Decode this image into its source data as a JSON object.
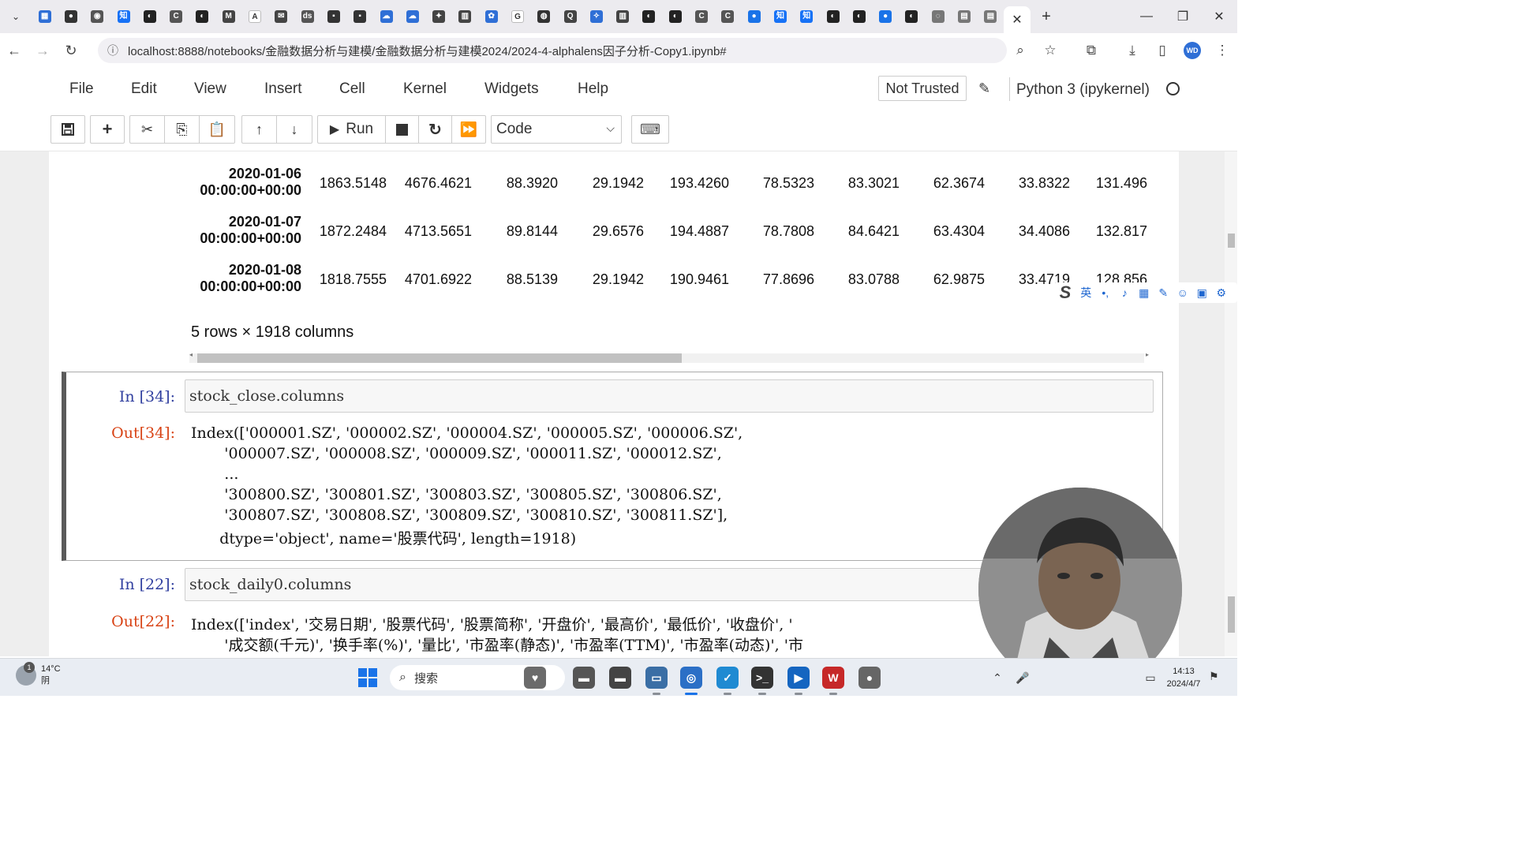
{
  "browser": {
    "tab_menu_glyph": "⌄",
    "tab_favicons": [
      {
        "name": "calendar",
        "color": "#2f6fd6",
        "glyph": "▦"
      },
      {
        "name": "chat",
        "color": "#333333",
        "glyph": "●"
      },
      {
        "name": "circle-app",
        "color": "#555555",
        "glyph": "◉"
      },
      {
        "name": "zhihu",
        "color": "#1772f6",
        "glyph": "知"
      },
      {
        "name": "github",
        "color": "#222222",
        "glyph": "◐"
      },
      {
        "name": "c-app",
        "color": "#555555",
        "glyph": "C"
      },
      {
        "name": "github",
        "color": "#222222",
        "glyph": "◐"
      },
      {
        "name": "m-app",
        "color": "#444444",
        "glyph": "M"
      },
      {
        "name": "a-app",
        "color": "#ffffff",
        "glyph": "A"
      },
      {
        "name": "mail",
        "color": "#444444",
        "glyph": "✉"
      },
      {
        "name": "ds-app",
        "color": "#555555",
        "glyph": "ds"
      },
      {
        "name": "square-app",
        "color": "#333333",
        "glyph": "▪"
      },
      {
        "name": "square-app",
        "color": "#333333",
        "glyph": "▪"
      },
      {
        "name": "cloud",
        "color": "#2f6fd6",
        "glyph": "☁"
      },
      {
        "name": "cloud",
        "color": "#2f6fd6",
        "glyph": "☁"
      },
      {
        "name": "run-app",
        "color": "#444444",
        "glyph": "✦"
      },
      {
        "name": "book-app",
        "color": "#444444",
        "glyph": "▥"
      },
      {
        "name": "paw-app",
        "color": "#2f6fd6",
        "glyph": "✿"
      },
      {
        "name": "google",
        "color": "#ffffff",
        "glyph": "G"
      },
      {
        "name": "globe",
        "color": "#333333",
        "glyph": "◍"
      },
      {
        "name": "q-app",
        "color": "#444444",
        "glyph": "Q"
      },
      {
        "name": "star-app",
        "color": "#2f6fd6",
        "glyph": "✧"
      },
      {
        "name": "book-app",
        "color": "#444444",
        "glyph": "▥"
      },
      {
        "name": "github",
        "color": "#222222",
        "glyph": "◐"
      },
      {
        "name": "github",
        "color": "#222222",
        "glyph": "◐"
      },
      {
        "name": "c-app",
        "color": "#555555",
        "glyph": "C"
      },
      {
        "name": "c-app",
        "color": "#555555",
        "glyph": "C"
      },
      {
        "name": "blue-app",
        "color": "#1a73e8",
        "glyph": "●"
      },
      {
        "name": "zhihu",
        "color": "#1772f6",
        "glyph": "知"
      },
      {
        "name": "zhihu",
        "color": "#1772f6",
        "glyph": "知"
      },
      {
        "name": "github",
        "color": "#222222",
        "glyph": "◐"
      },
      {
        "name": "github",
        "color": "#222222",
        "glyph": "◐"
      },
      {
        "name": "blue-app",
        "color": "#1a73e8",
        "glyph": "●"
      },
      {
        "name": "github",
        "color": "#222222",
        "glyph": "◐"
      },
      {
        "name": "loading",
        "color": "#777777",
        "glyph": "◌"
      },
      {
        "name": "doc-app",
        "color": "#777777",
        "glyph": "▤"
      },
      {
        "name": "doc-app",
        "color": "#777777",
        "glyph": "▤"
      }
    ],
    "active_tab_close": "✕",
    "new_tab": "+",
    "window_controls": {
      "minimize": "—",
      "restore": "❐",
      "close": "✕"
    },
    "nav": {
      "back": "←",
      "forward": "→",
      "reload": "↻"
    },
    "url_icon": "ⓘ",
    "url": "localhost:8888/notebooks/金融数据分析与建模/金融数据分析与建模2024/2024-4-alphalens因子分析-Copy1.ipynb#",
    "addr_icons": {
      "zoom": "⌕",
      "bookmark": "☆",
      "extensions": "⧉",
      "download": "⤓",
      "sidebar": "▯",
      "profile": "WD",
      "more": "⋮"
    }
  },
  "jupyter": {
    "menu": [
      "File",
      "Edit",
      "View",
      "Insert",
      "Cell",
      "Kernel",
      "Widgets",
      "Help"
    ],
    "trust": "Not Trusted",
    "kernel": "Python 3 (ipykernel)",
    "toolbar": {
      "run_label": "Run",
      "cell_type": "Code"
    }
  },
  "dataframe": {
    "rows": [
      {
        "date": "2020-01-06",
        "time": "00:00:00+00:00",
        "values": [
          "1863.5148",
          "4676.4621",
          "88.3920",
          "29.1942",
          "193.4260",
          "78.5323",
          "83.3021",
          "62.3674",
          "33.8322",
          "131.496"
        ]
      },
      {
        "date": "2020-01-07",
        "time": "00:00:00+00:00",
        "values": [
          "1872.2484",
          "4713.5651",
          "89.8144",
          "29.6576",
          "194.4887",
          "78.7808",
          "84.6421",
          "63.4304",
          "34.4086",
          "132.817"
        ]
      },
      {
        "date": "2020-01-08",
        "time": "00:00:00+00:00",
        "values": [
          "1818.7555",
          "4701.6922",
          "88.5139",
          "29.1942",
          "190.9461",
          "77.8696",
          "83.0788",
          "62.9875",
          "33.4719",
          "128.856"
        ]
      }
    ],
    "summary": "5 rows × 1918 columns"
  },
  "cells": [
    {
      "in_prompt": "In  [34]:",
      "code": "stock_close.columns",
      "out_prompt": "Out[34]:",
      "output": [
        "Index(['000001.SZ', '000002.SZ', '000004.SZ', '000005.SZ', '000006.SZ',",
        "       '000007.SZ', '000008.SZ', '000009.SZ', '000011.SZ', '000012.SZ',",
        "       ...",
        "       '300800.SZ', '300801.SZ', '300803.SZ', '300805.SZ', '300806.SZ',",
        "       '300807.SZ', '300808.SZ', '300809.SZ', '300810.SZ', '300811.SZ'],",
        "      dtype='object', name='股票代码', length=1918)"
      ]
    },
    {
      "in_prompt": "In  [22]:",
      "code": "stock_daily0.columns",
      "out_prompt": "Out[22]:",
      "output": [
        "Index(['index', '交易日期', '股票代码', '股票简称', '开盘价', '最高价', '最低价', '收盘价', '",
        "       '成交额(千元)', '换手率(%)', '量比', '市盈率(静态)', '市盈率(TTM)', '市盈率(动态)', '市"
      ]
    }
  ],
  "ime": {
    "logo": "S",
    "items": [
      "英",
      "•,",
      "♪",
      "▦",
      "✎",
      "☺",
      "▣",
      "⚙"
    ]
  },
  "taskbar": {
    "weather_badge": "1",
    "temperature": "14°C",
    "condition": "阴",
    "search_placeholder": "搜索",
    "apps": [
      {
        "name": "widgets",
        "color": "#6b6b6b",
        "glyph": "♥"
      },
      {
        "name": "file-manager",
        "color": "#555555",
        "glyph": "▬"
      },
      {
        "name": "terminal-dark",
        "color": "#444444",
        "glyph": "▬"
      },
      {
        "name": "folder",
        "color": "#3a6ea5",
        "glyph": "▭"
      },
      {
        "name": "chrome",
        "color": "#2b6fc6",
        "glyph": "◎"
      },
      {
        "name": "vscode-blue",
        "color": "#1f8ad2",
        "glyph": "✓"
      },
      {
        "name": "terminal",
        "color": "#333333",
        "glyph": ">_"
      },
      {
        "name": "recorder",
        "color": "#1565c0",
        "glyph": "▶"
      },
      {
        "name": "wps",
        "color": "#c62828",
        "glyph": "W"
      },
      {
        "name": "obs",
        "color": "#666666",
        "glyph": "●"
      }
    ],
    "tray": [
      "⌃",
      "🎤",
      "▭"
    ],
    "time": "14:13",
    "date": "2024/4/7",
    "notify": "⚑"
  }
}
